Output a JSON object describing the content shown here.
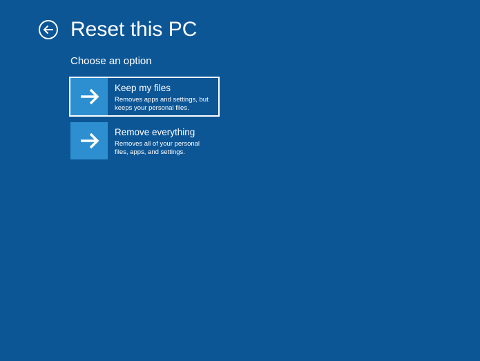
{
  "header": {
    "title": "Reset this PC"
  },
  "content": {
    "subtitle": "Choose an option",
    "options": [
      {
        "title": "Keep my files",
        "desc": "Removes apps and settings, but keeps your personal files."
      },
      {
        "title": "Remove everything",
        "desc": "Removes all of your personal files, apps, and settings."
      }
    ]
  }
}
